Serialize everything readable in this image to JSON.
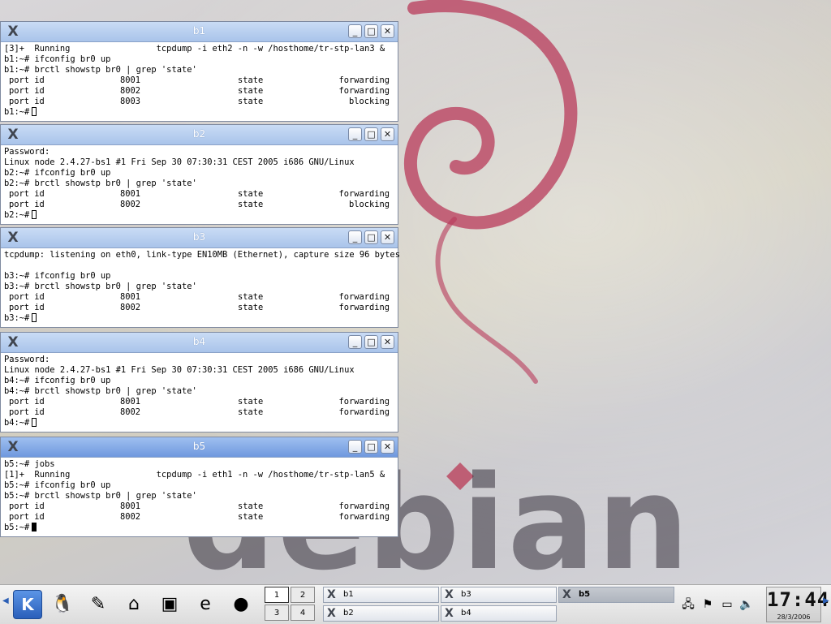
{
  "windows": [
    {
      "title": "b1",
      "lines": [
        {
          "text": "[3]+  Running                 tcpdump -i eth2 -n -w /hosthome/tr-stp-lan3 &"
        },
        {
          "text": "b1:~# ifconfig br0 up"
        },
        {
          "text": "b1:~# brctl showstp br0 | grep 'state'"
        },
        {
          "cols": [
            "port id",
            "8001",
            "state",
            "forwarding"
          ]
        },
        {
          "cols": [
            "port id",
            "8002",
            "state",
            "forwarding"
          ]
        },
        {
          "cols": [
            "port id",
            "8003",
            "state",
            "blocking"
          ]
        },
        {
          "text": "b1:~#",
          "cursor": true
        }
      ]
    },
    {
      "title": "b2",
      "lines": [
        {
          "text": "Password:"
        },
        {
          "text": "Linux node 2.4.27-bs1 #1 Fri Sep 30 07:30:31 CEST 2005 i686 GNU/Linux"
        },
        {
          "text": "b2:~# ifconfig br0 up"
        },
        {
          "text": "b2:~# brctl showstp br0 | grep 'state'"
        },
        {
          "cols": [
            "port id",
            "8001",
            "state",
            "forwarding"
          ]
        },
        {
          "cols": [
            "port id",
            "8002",
            "state",
            "blocking"
          ]
        },
        {
          "text": "b2:~#",
          "cursor": true
        }
      ]
    },
    {
      "title": "b3",
      "lines": [
        {
          "text": "tcpdump: listening on eth0, link-type EN10MB (Ethernet), capture size 96 bytes"
        },
        {
          "text": ""
        },
        {
          "text": "b3:~# ifconfig br0 up"
        },
        {
          "text": "b3:~# brctl showstp br0 | grep 'state'"
        },
        {
          "cols": [
            "port id",
            "8001",
            "state",
            "forwarding"
          ]
        },
        {
          "cols": [
            "port id",
            "8002",
            "state",
            "forwarding"
          ]
        },
        {
          "text": "b3:~#",
          "cursor": true
        }
      ]
    },
    {
      "title": "b4",
      "lines": [
        {
          "text": "Password:"
        },
        {
          "text": "Linux node 2.4.27-bs1 #1 Fri Sep 30 07:30:31 CEST 2005 i686 GNU/Linux"
        },
        {
          "text": "b4:~# ifconfig br0 up"
        },
        {
          "text": "b4:~# brctl showstp br0 | grep 'state'"
        },
        {
          "cols": [
            "port id",
            "8001",
            "state",
            "forwarding"
          ]
        },
        {
          "cols": [
            "port id",
            "8002",
            "state",
            "forwarding"
          ]
        },
        {
          "text": "b4:~#",
          "cursor": true
        }
      ]
    },
    {
      "title": "b5",
      "active": true,
      "lines": [
        {
          "text": "b5:~# jobs"
        },
        {
          "text": "[1]+  Running                 tcpdump -i eth1 -n -w /hosthome/tr-stp-lan5 &"
        },
        {
          "text": "b5:~# ifconfig br0 up"
        },
        {
          "text": "b5:~# brctl showstp br0 | grep 'state'"
        },
        {
          "cols": [
            "port id",
            "8001",
            "state",
            "forwarding"
          ]
        },
        {
          "cols": [
            "port id",
            "8002",
            "state",
            "forwarding"
          ]
        },
        {
          "text": "b5:~#",
          "cursor": true,
          "filled": true
        }
      ]
    }
  ],
  "window_buttons": {
    "minimize": "_",
    "maximize": "□",
    "close": "✕"
  },
  "wallpaper": {
    "logo_text": "debian",
    "accent": "#b83a55"
  },
  "taskbar": {
    "launchers": [
      {
        "name": "kmenu-icon",
        "glyph": "K"
      },
      {
        "name": "tux-icon",
        "glyph": "🐧"
      },
      {
        "name": "editor-icon",
        "glyph": "✎"
      },
      {
        "name": "home-icon",
        "glyph": "⌂"
      },
      {
        "name": "terminal-icon",
        "glyph": "▣"
      },
      {
        "name": "emacs-icon",
        "glyph": "e"
      },
      {
        "name": "browser-icon",
        "glyph": "●"
      }
    ],
    "pager": [
      "1",
      "2",
      "3",
      "4"
    ],
    "tasks": [
      {
        "label": "b1"
      },
      {
        "label": "b3"
      },
      {
        "label": "b5",
        "active": true
      },
      {
        "label": "b2"
      },
      {
        "label": "b4"
      }
    ],
    "clock": {
      "time": "17:44",
      "date": "28/3/2006"
    }
  }
}
